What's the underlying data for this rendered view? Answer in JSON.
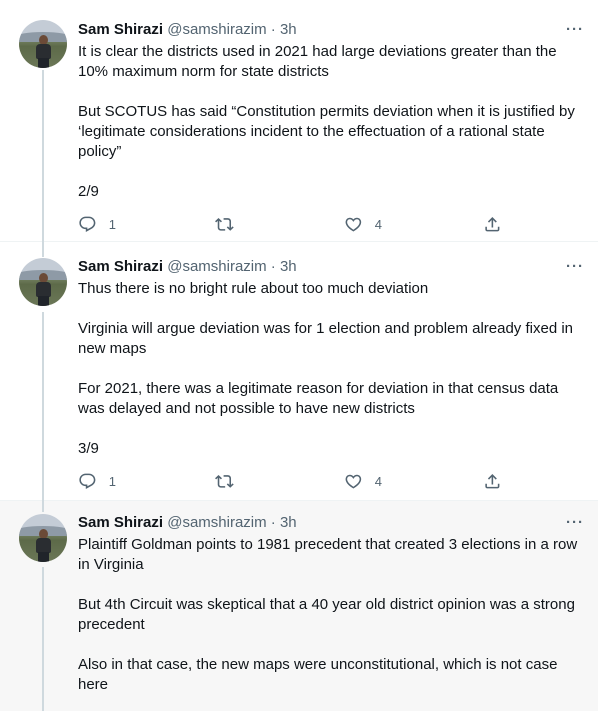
{
  "tweets": [
    {
      "name": "Sam Shirazi",
      "handle": "@samshirazim",
      "separator": "·",
      "time": "3h",
      "paragraphs": [
        "It is clear the districts used in 2021 had large deviations greater than the 10% maximum norm for state districts",
        "But SCOTUS has said “Constitution permits deviation when it is justified by ‘legitimate considerations incident to the effectuation of a rational state policy”",
        "2/9"
      ],
      "replies": "1",
      "retweets": "",
      "likes": "4"
    },
    {
      "name": "Sam Shirazi",
      "handle": "@samshirazim",
      "separator": "·",
      "time": "3h",
      "paragraphs": [
        "Thus there is no bright rule about too much deviation",
        "Virginia will argue deviation was for 1 election and problem already fixed in new maps",
        "For 2021, there was a legitimate reason for deviation in that census data was delayed and not possible to have new districts",
        "3/9"
      ],
      "replies": "1",
      "retweets": "",
      "likes": "4"
    },
    {
      "name": "Sam Shirazi",
      "handle": "@samshirazim",
      "separator": "·",
      "time": "3h",
      "paragraphs": [
        "Plaintiff Goldman points to 1981 precedent that created 3 elections in a row in Virginia",
        "But 4th Circuit was skeptical that a 40 year old district opinion was a strong precedent",
        "Also in that case, the new maps were unconstitutional, which is not case here"
      ]
    }
  ],
  "icons": {
    "reply": "reply-icon",
    "retweet": "retweet-icon",
    "like": "heart-icon",
    "share": "share-icon",
    "more": "more-icon"
  },
  "colors": {
    "text": "#0f1419",
    "secondary": "#536471",
    "thread_line": "#cfd9de",
    "hover_bg": "#f7f7f7"
  }
}
